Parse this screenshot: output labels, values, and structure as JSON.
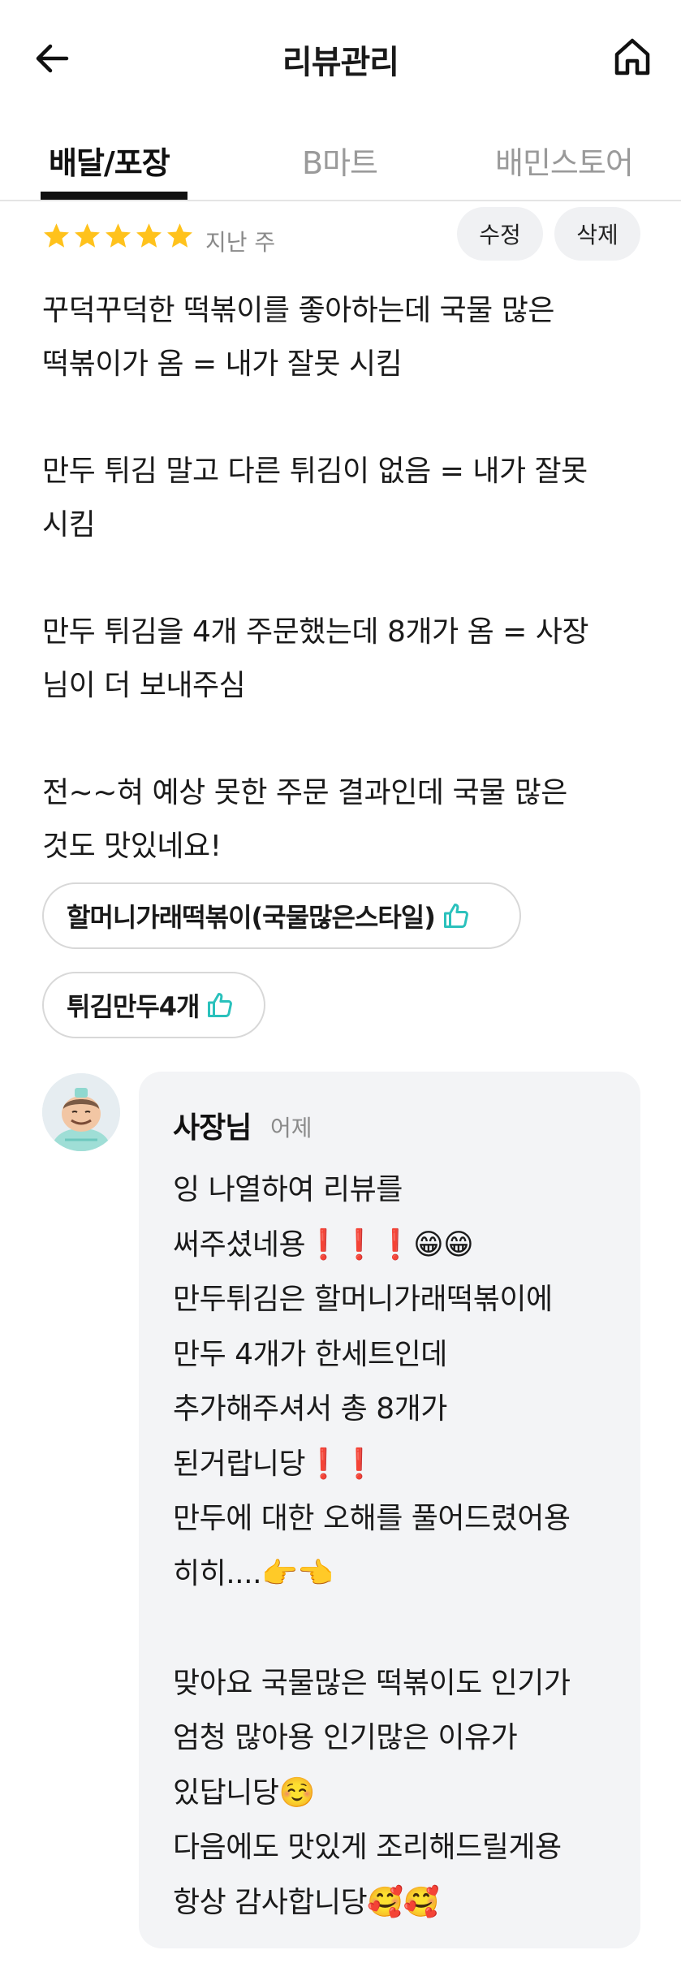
{
  "header": {
    "title": "리뷰관리",
    "back_icon": "arrow-left-icon",
    "home_icon": "home-icon"
  },
  "tabs": [
    {
      "label": "배달/포장",
      "active": true
    },
    {
      "label": "B마트",
      "active": false
    },
    {
      "label": "배민스토어",
      "active": false
    }
  ],
  "review": {
    "rating": 5,
    "date": "지난 주",
    "edit_label": "수정",
    "delete_label": "삭제",
    "text": "꾸덕꾸덕한 떡볶이를 좋아하는데 국물 많은\n떡볶이가 옴 = 내가 잘못 시킴\n\n만두 튀김 말고 다른 튀김이 없음 = 내가 잘못\n시킴\n\n만두 튀김을 4개 주문했는데 8개가 옴 = 사장\n님이 더 보내주심\n\n전~~혀 예상 못한 주문 결과인데 국물 많은\n것도 맛있네요!",
    "menu_items": [
      {
        "label": "할머니가래떡볶이(국물많은스타일)"
      },
      {
        "label": "튀김만두4개"
      }
    ]
  },
  "reply": {
    "author": "사장님",
    "date": "어제",
    "text": "잉 나열하여 리뷰를\n써주셨네용❗❗❗😁😁\n만두튀김은 할머니가래떡볶이에\n만두 4개가 한세트인데\n추가해주셔서 총 8개가\n된거랍니당❗❗\n만두에 대한 오해를 풀어드렸어용\n히히....👉👈\n\n맞아요 국물많은 떡볶이도 인기가\n엄청 많아용 인기많은 이유가\n있답니당☺️\n다음에도 맛있게 조리해드릴게용\n항상 감사합니당🥰🥰"
  },
  "colors": {
    "star": "#FFC21C",
    "thumb": "#2AC1BC",
    "text": "#1a1a1a",
    "muted": "#8a8a8a",
    "pill_bg": "#f0f1f3",
    "reply_bg": "#f3f4f6"
  }
}
